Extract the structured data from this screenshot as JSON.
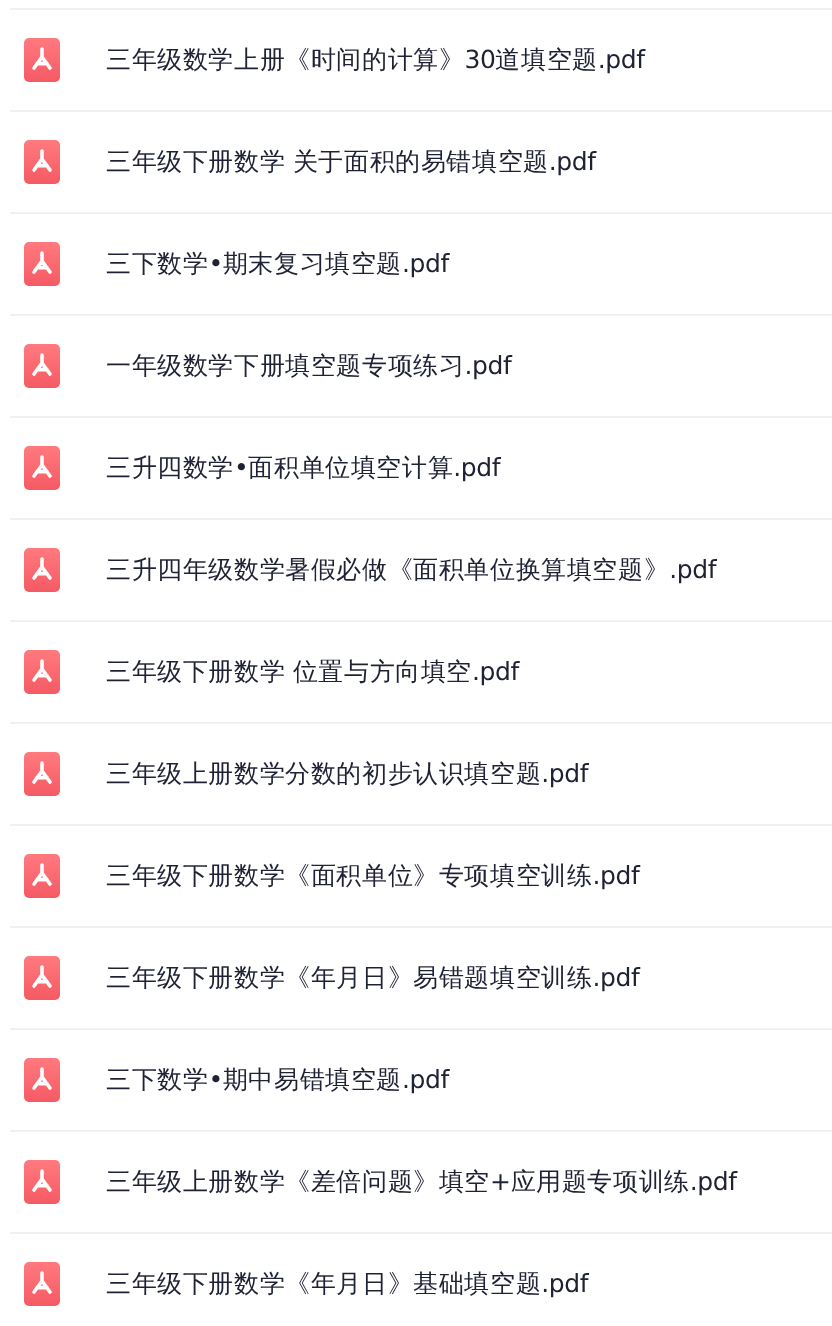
{
  "files": [
    {
      "name": "三年级数学上册《时间的计算》30道填空题.pdf"
    },
    {
      "name": "三年级下册数学 关于面积的易错填空题.pdf"
    },
    {
      "name": "三下数学•期末复习填空题.pdf"
    },
    {
      "name": "一年级数学下册填空题专项练习.pdf"
    },
    {
      "name": "三升四数学•面积单位填空计算.pdf"
    },
    {
      "name": "三升四年级数学暑假必做《面积单位换算填空题》.pdf"
    },
    {
      "name": "三年级下册数学 位置与方向填空.pdf"
    },
    {
      "name": "三年级上册数学分数的初步认识填空题.pdf"
    },
    {
      "name": "三年级下册数学《面积单位》专项填空训练.pdf"
    },
    {
      "name": "三年级下册数学《年月日》易错题填空训练.pdf"
    },
    {
      "name": "三下数学•期中易错填空题.pdf"
    },
    {
      "name": "三年级上册数学《差倍问题》填空+应用题专项训练.pdf"
    },
    {
      "name": "三年级下册数学《年月日》基础填空题.pdf"
    }
  ]
}
